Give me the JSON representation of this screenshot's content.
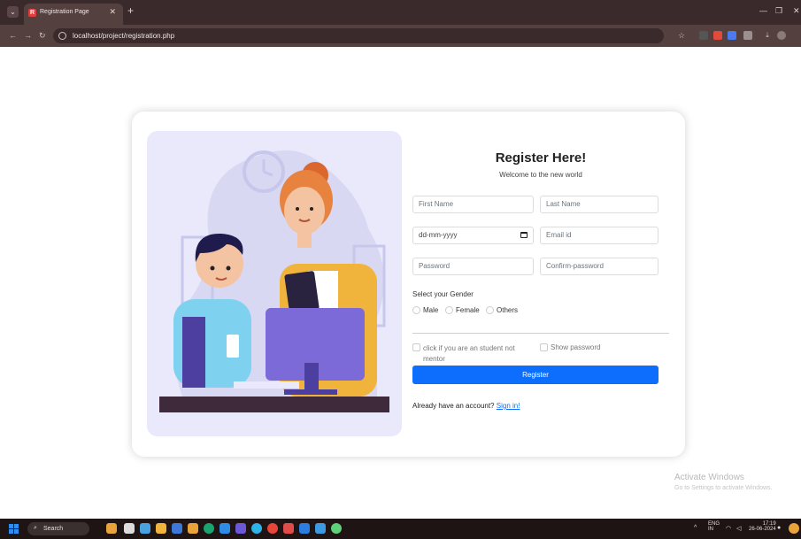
{
  "browser": {
    "tab_title": "Registration Page",
    "tab_favicon_letter": "R",
    "url": "localhost/project/registration.php"
  },
  "form": {
    "title": "Register Here!",
    "subtitle": "Welcome to the new world",
    "first_name_placeholder": "First Name",
    "last_name_placeholder": "Last Name",
    "date_placeholder": "dd-mm-yyyy",
    "email_placeholder": "Email id",
    "password_placeholder": "Password",
    "confirm_password_placeholder": "Confirm-password",
    "gender_label": "Select your Gender",
    "gender_options": [
      "Male",
      "Female",
      "Others"
    ],
    "student_checkbox_label": "click if you are an student not mentor",
    "show_password_label": "Show password",
    "register_button": "Register",
    "already_text": "Already have an account?",
    "sign_in_link": "Sign in!"
  },
  "watermark": {
    "line1": "Activate Windows",
    "line2": "Go to Settings to activate Windows."
  },
  "taskbar": {
    "search_label": "Search",
    "lang_top": "ENG",
    "lang_bottom": "IN",
    "time": "17:19",
    "date": "26-06-2024"
  },
  "colors": {
    "accent": "#0d6efd",
    "browser_frame": "#3a2a2c",
    "illustration_bg": "#e9e9fb"
  }
}
